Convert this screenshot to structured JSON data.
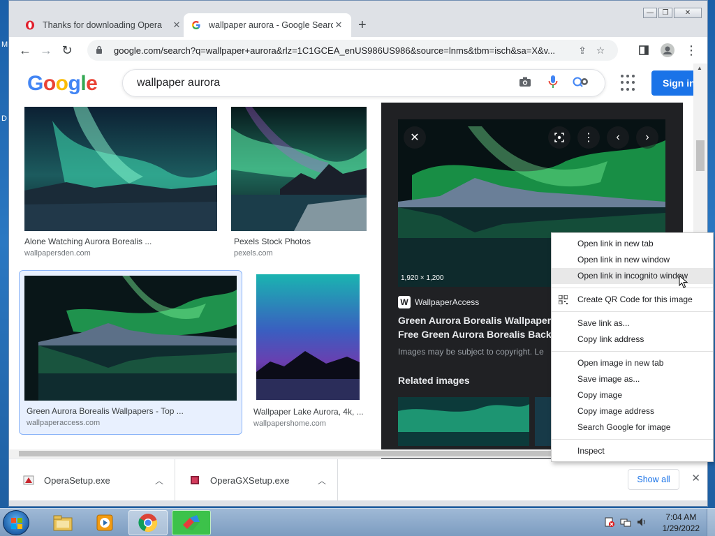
{
  "desktop": {
    "glyph_m": "M",
    "glyph_d": "D"
  },
  "window": {
    "minimize": "—",
    "maximize": "❐",
    "close": "✕"
  },
  "tabs": [
    {
      "title": "Thanks for downloading Opera",
      "favicon": "opera-icon"
    },
    {
      "title": "wallpaper aurora - Google Search",
      "favicon": "google-icon"
    }
  ],
  "newtab_label": "+",
  "toolbar": {
    "url": "google.com/search?q=wallpaper+aurora&rlz=1C1GCEA_enUS986US986&source=lnms&tbm=isch&sa=X&v...",
    "back": "←",
    "forward": "→",
    "reload": "↻"
  },
  "google": {
    "logo_letters": [
      "G",
      "o",
      "o",
      "g",
      "l",
      "e"
    ],
    "logo_colors": [
      "#4285F4",
      "#EA4335",
      "#FBBC05",
      "#4285F4",
      "#34A853",
      "#EA4335"
    ],
    "query": "wallpaper aurora",
    "signin": "Sign in"
  },
  "results": [
    {
      "caption": "Alone Watching Aurora Borealis ...",
      "source": "wallpapersden.com"
    },
    {
      "caption": "Pexels Stock Photos",
      "source": "pexels.com"
    },
    {
      "caption": "Green Aurora Borealis Wallpapers - Top ...",
      "source": "wallpaperaccess.com"
    },
    {
      "caption": "Wallpaper Lake Aurora, 4k, ...",
      "source": "wallpapershome.com"
    }
  ],
  "preview": {
    "dimensions": "1,920 × 1,200",
    "site_logo": "W",
    "site": "WallpaperAccess",
    "title_line1": "Green Aurora Borealis Wallpaper",
    "title_line2": "Free Green Aurora Borealis Backg",
    "copyright": "Images may be subject to copyright. Le",
    "related": "Related images"
  },
  "context_menu": {
    "items": [
      "Open link in new tab",
      "Open link in new window",
      "Open link in incognito window",
      "Create QR Code for this image",
      "Save link as...",
      "Copy link address",
      "Open image in new tab",
      "Save image as...",
      "Copy image",
      "Copy image address",
      "Search Google for image",
      "Inspect"
    ],
    "highlighted": "Open link in incognito window"
  },
  "downloads": [
    {
      "name": "OperaSetup.exe"
    },
    {
      "name": "OperaGXSetup.exe"
    }
  ],
  "shelf": {
    "show_all": "Show all",
    "close": "✕"
  },
  "taskbar": {
    "time": "7:04 AM",
    "date": "1/29/2022"
  }
}
